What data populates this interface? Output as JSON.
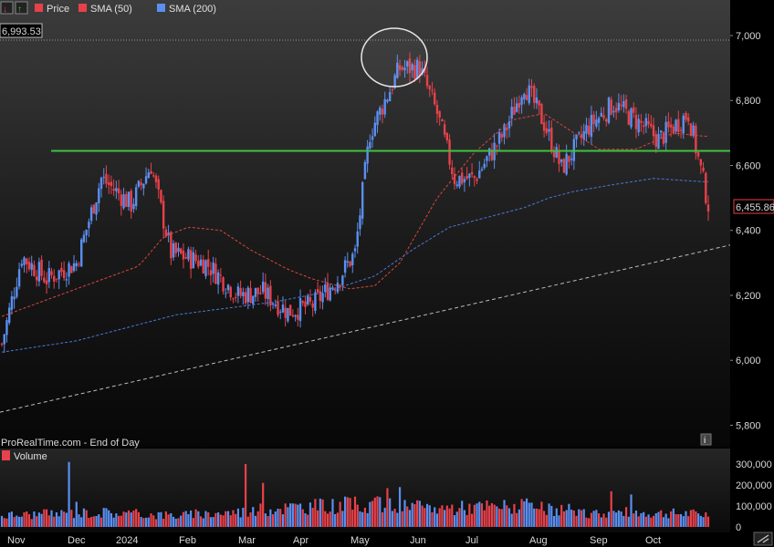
{
  "legend": {
    "price_label": "Price",
    "sma50_label": "SMA (50)",
    "sma200_label": "SMA (200)",
    "volume_label": "Volume"
  },
  "watermark": "ProRealTime.com - End of Day",
  "info_icon": "i",
  "colors": {
    "up": "#5b8ff0",
    "down": "#e8414a",
    "sma50": "#d9463f",
    "sma200": "#4a78d8",
    "resistance": "#3fc23f",
    "trendline": "#bbbbbb"
  },
  "chart_data": {
    "type": "candlestick",
    "y_ticks": [
      "7,000",
      "6,800",
      "6,600",
      "6,400",
      "6,200",
      "6,000",
      "5,800"
    ],
    "volume_ticks": [
      "300,000",
      "200,000",
      "100,000",
      "0"
    ],
    "ylim": [
      5780,
      7080
    ],
    "x_labels": [
      "Nov",
      "Dec",
      "2024",
      "Feb",
      "Mar",
      "Apr",
      "May",
      "Jun",
      "Jul",
      "Aug",
      "Sep",
      "Oct"
    ],
    "high_marker": "6,993.53",
    "last_price": "6,455.86",
    "resistance_level": 6645,
    "trendline": {
      "start": 5840,
      "end": 6355
    },
    "sma50_anchors": [
      [
        0,
        6135
      ],
      [
        30,
        6220
      ],
      [
        55,
        6290
      ],
      [
        65,
        6380
      ],
      [
        75,
        6410
      ],
      [
        88,
        6400
      ],
      [
        100,
        6340
      ],
      [
        115,
        6280
      ],
      [
        125,
        6250
      ],
      [
        140,
        6220
      ],
      [
        150,
        6230
      ],
      [
        160,
        6300
      ],
      [
        175,
        6500
      ],
      [
        190,
        6640
      ],
      [
        205,
        6740
      ],
      [
        218,
        6760
      ],
      [
        230,
        6700
      ],
      [
        240,
        6650
      ],
      [
        255,
        6650
      ],
      [
        270,
        6700
      ],
      [
        282,
        6690
      ]
    ],
    "sma200_anchors": [
      [
        0,
        6025
      ],
      [
        30,
        6060
      ],
      [
        55,
        6110
      ],
      [
        70,
        6140
      ],
      [
        90,
        6160
      ],
      [
        110,
        6180
      ],
      [
        130,
        6210
      ],
      [
        150,
        6260
      ],
      [
        165,
        6340
      ],
      [
        180,
        6410
      ],
      [
        195,
        6440
      ],
      [
        210,
        6470
      ],
      [
        220,
        6500
      ],
      [
        230,
        6520
      ],
      [
        245,
        6540
      ],
      [
        262,
        6560
      ],
      [
        282,
        6550
      ]
    ],
    "price_anchors": [
      [
        0,
        6050
      ],
      [
        8,
        6320
      ],
      [
        18,
        6250
      ],
      [
        30,
        6300
      ],
      [
        40,
        6560
      ],
      [
        52,
        6480
      ],
      [
        60,
        6600
      ],
      [
        68,
        6330
      ],
      [
        82,
        6300
      ],
      [
        95,
        6200
      ],
      [
        105,
        6210
      ],
      [
        115,
        6150
      ],
      [
        125,
        6170
      ],
      [
        135,
        6250
      ],
      [
        142,
        6330
      ],
      [
        148,
        6700
      ],
      [
        160,
        6900
      ],
      [
        168,
        6900
      ],
      [
        175,
        6760
      ],
      [
        182,
        6560
      ],
      [
        190,
        6560
      ],
      [
        202,
        6700
      ],
      [
        210,
        6850
      ],
      [
        218,
        6730
      ],
      [
        225,
        6590
      ],
      [
        236,
        6720
      ],
      [
        246,
        6790
      ],
      [
        258,
        6720
      ],
      [
        264,
        6680
      ],
      [
        276,
        6760
      ],
      [
        284,
        6480
      ]
    ],
    "volume_anchors": [
      [
        0,
        55000
      ],
      [
        40,
        70000
      ],
      [
        70,
        55000
      ],
      [
        100,
        75000
      ],
      [
        110,
        90000
      ],
      [
        150,
        110000
      ],
      [
        160,
        95000
      ],
      [
        175,
        90000
      ],
      [
        210,
        100000
      ],
      [
        230,
        60000
      ],
      [
        250,
        70000
      ],
      [
        284,
        60000
      ]
    ]
  }
}
